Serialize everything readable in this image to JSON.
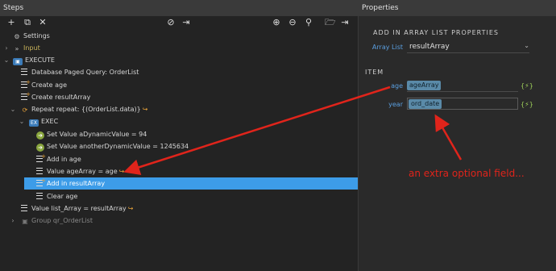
{
  "steps_panel": {
    "title": "Steps",
    "toolbar": [
      {
        "name": "add",
        "glyph": "+"
      },
      {
        "name": "duplicate",
        "glyph": "⧉"
      },
      {
        "name": "delete",
        "glyph": "✕"
      },
      {
        "name": "disable",
        "glyph": "⊘"
      },
      {
        "name": "export",
        "glyph": "⇥"
      },
      {
        "name": "zoom-in",
        "glyph": "⊕"
      },
      {
        "name": "zoom-out",
        "glyph": "⊖"
      },
      {
        "name": "search",
        "glyph": "⚲"
      },
      {
        "name": "open-folder",
        "glyph": "🗁"
      },
      {
        "name": "share",
        "glyph": "⇥"
      }
    ],
    "tree": [
      {
        "label": "Settings",
        "icon": "gear-icon",
        "glyph": "⚙"
      },
      {
        "label": "Input",
        "icon": "input-icon",
        "glyph": "»"
      },
      {
        "label": "EXECUTE",
        "icon": "execute-icon",
        "glyph": "▣"
      },
      {
        "label": "Database Paged Query: OrderList",
        "icon": "database-icon",
        "glyph": ""
      },
      {
        "label": "Create age",
        "icon": "create-variable-icon",
        "glyph": ""
      },
      {
        "label": "Create resultArray",
        "icon": "create-variable-icon",
        "glyph": ""
      },
      {
        "label": "Repeat repeat: {(OrderList.data)}",
        "icon": "repeat-icon",
        "glyph": "⟳"
      },
      {
        "label": "EXEC",
        "icon": "exec-icon",
        "glyph": "EX"
      },
      {
        "label": "Set Value aDynamicValue = 94",
        "icon": "set-value-icon",
        "glyph": "➜"
      },
      {
        "label": "Set Value anotherDynamicValue = 1245634",
        "icon": "set-value-icon",
        "glyph": "➜"
      },
      {
        "label": "Add in age",
        "icon": "add-in-icon",
        "glyph": ""
      },
      {
        "label": "Value ageArray = age",
        "icon": "value-icon",
        "glyph": ""
      },
      {
        "label": "Add in resultArray",
        "icon": "add-in-icon",
        "glyph": ""
      },
      {
        "label": "Clear age",
        "icon": "clear-icon",
        "glyph": ""
      },
      {
        "label": "Value list_Array = resultArray",
        "icon": "value-icon",
        "glyph": ""
      },
      {
        "label": "Group qr_OrderList",
        "icon": "group-icon",
        "glyph": "▣"
      }
    ]
  },
  "properties_panel": {
    "title": "Properties",
    "section_title": "ADD IN ARRAY LIST PROPERTIES",
    "array_list_label": "Array List",
    "array_list_value": "resultArray",
    "item_title": "ITEM",
    "fields": [
      {
        "label": "age",
        "value": "ageArray"
      },
      {
        "label": "year",
        "value": "ord_date"
      }
    ],
    "lightning_glyph": "{⚡}"
  },
  "annotation": {
    "text": "an extra optional field...",
    "color": "#e0241b"
  },
  "colors": {
    "selection": "#3d9ce8",
    "accent_blue": "#5a9fe0",
    "warning_orange": "#e8a33a"
  }
}
